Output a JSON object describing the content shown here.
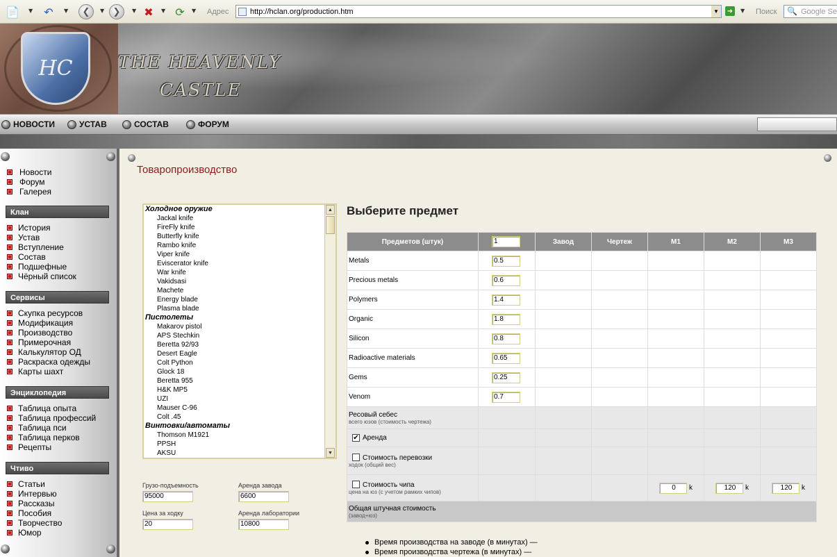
{
  "browser": {
    "address_label": "Адрес",
    "url": "http://hclan.org/production.htm",
    "search_label": "Поиск",
    "search_placeholder": "Google Se"
  },
  "site": {
    "logo_monogram": "HC",
    "logo_line1": "THE HEAVENLY",
    "logo_line2": "CASTLE",
    "nav": [
      "НОВОСТИ",
      "УСТАВ",
      "СОСТАВ",
      "ФОРУМ"
    ]
  },
  "sidebar": {
    "top_links": [
      "Новости",
      "Форум",
      "Галерея"
    ],
    "groups": [
      {
        "title": "Клан",
        "items": [
          "История",
          "Устав",
          "Вступление",
          "Состав",
          "Подшефные",
          "Чёрный список"
        ]
      },
      {
        "title": "Сервисы",
        "items": [
          "Скупка ресурсов",
          "Модификация",
          "Производство",
          "Примерочная",
          "Калькулятор ОД",
          "Раскраска одежды",
          "Карты шахт"
        ]
      },
      {
        "title": "Энциклопедия",
        "items": [
          "Таблица опыта",
          "Таблица профессий",
          "Таблица пси",
          "Таблица перков",
          "Рецепты"
        ]
      },
      {
        "title": "Чтиво",
        "items": [
          "Статьи",
          "Интервью",
          "Рассказы",
          "Пособия",
          "Творчество",
          "Юмор"
        ]
      }
    ]
  },
  "page": {
    "title": "Товаропроизводство",
    "select_title": "Выберите предмет"
  },
  "item_list": [
    {
      "group": "Холодное оружие",
      "items": [
        "Jackal knife",
        "FireFly knife",
        "Butterfly knife",
        "Rambo knife",
        "Viper knife",
        "Eviscerator knife",
        "War knife",
        "Vakidsasi",
        "Machete",
        "Energy blade",
        "Plasma blade"
      ]
    },
    {
      "group": "Пистолеты",
      "items": [
        "Makarov pistol",
        "APS Stechkin",
        "Beretta 92/93",
        "Desert Eagle",
        "Colt Python",
        "Glock 18",
        "Beretta 955",
        "H&K MP5",
        "UZI",
        "Mauser C-96",
        "Colt .45"
      ]
    },
    {
      "group": "Винтовки/автоматы",
      "items": [
        "Thomson M1921",
        "PPSH",
        "AKSU"
      ]
    }
  ],
  "fields": {
    "capacity_label": "Грузо-подъемность",
    "capacity_value": "95000",
    "factory_rent_label": "Аренда завода",
    "factory_rent_value": "6600",
    "move_price_label": "Цена за ходку",
    "move_price_value": "20",
    "lab_rent_label": "Аренда лаборатории",
    "lab_rent_value": "10800"
  },
  "table": {
    "headers": [
      "Предметов (штук)",
      "Завод",
      "Чертеж",
      "M1",
      "M2",
      "M3"
    ],
    "quantity": "1",
    "rows": [
      {
        "name": "Metals",
        "value": "0.5"
      },
      {
        "name": "Precious metals",
        "value": "0.6"
      },
      {
        "name": "Polymers",
        "value": "1.4"
      },
      {
        "name": "Organic",
        "value": "1.8"
      },
      {
        "name": "Silicon",
        "value": "0.8"
      },
      {
        "name": "Radioactive materials",
        "value": "0.65"
      },
      {
        "name": "Gems",
        "value": "0.25"
      },
      {
        "name": "Venom",
        "value": "0.7"
      }
    ],
    "resource_cost_label": "Ресовый себес",
    "resource_cost_sub": "всего юзов (стоимость чертежа)",
    "rent_label": "Аренда",
    "transport_label": "Стоимость перевозки",
    "transport_sub": "ходок (общий вес)",
    "chip_label": "Стоимость чипа",
    "chip_sub": "цена на юз (с учетом рамких чипов)",
    "chip_values": [
      "0",
      "120",
      "120"
    ],
    "chip_unit": "k",
    "total_label": "Общая штучная стоимость",
    "total_sub": "(завод+юз)"
  },
  "bullets": [
    "Время производства на заводе (в минутах) —",
    "Время производства чертежа (в минутах) —"
  ]
}
